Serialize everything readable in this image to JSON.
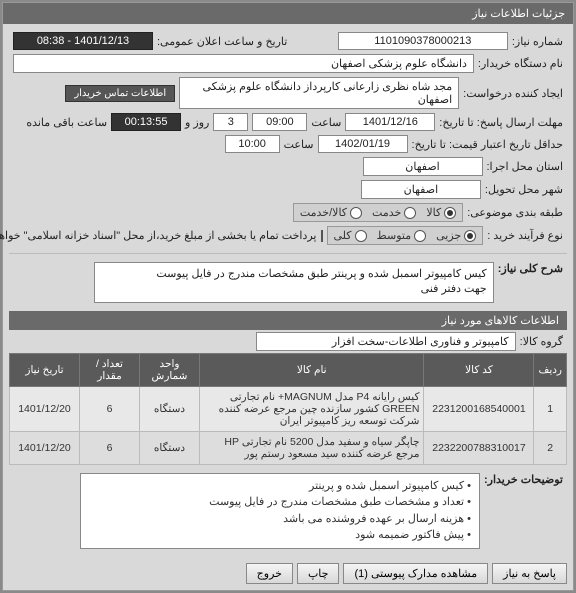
{
  "header": {
    "title": "جزئیات اطلاعات نیاز"
  },
  "top": {
    "need_no_lbl": "شماره نیاز:",
    "need_no": "1101090378000213",
    "public_time_lbl": "تاریخ و ساعت اعلان عمومی:",
    "public_time": "1401/12/13 - 08:38",
    "buyer_lbl": "نام دستگاه خریدار:",
    "buyer": "دانشگاه علوم پزشکی اصفهان",
    "creator_lbl": "ایجاد کننده درخواست:",
    "creator": "مجد شاه نظری زارعانی کارپرداز دانشگاه علوم پزشکی اصفهان",
    "contact": "اطلاعات تماس خریدار",
    "deadline_lbl": "مهلت ارسال پاسخ: تا تاریخ:",
    "deadline_date": "1401/12/16",
    "time_lbl": "ساعت",
    "deadline_time": "09:00",
    "days": "3",
    "days_lbl": "روز و",
    "countdown": "00:13:55",
    "remain_lbl": "ساعت باقی مانده",
    "validity_lbl": "حداقل تاریخ اعتبار قیمت: تا تاریخ:",
    "validity_date": "1402/01/19",
    "validity_time": "10:00",
    "exec_prov_lbl": "استان محل اجرا:",
    "exec_prov": "اصفهان",
    "deliv_city_lbl": "شهر محل تحویل:",
    "deliv_city": "اصفهان",
    "class_lbl": "طبقه بندی موضوعی:",
    "class_opts": {
      "a": "کالا",
      "b": "خدمت",
      "c": "کالا/خدمت"
    },
    "buy_lbl": "نوع فرآیند خرید :",
    "buy_opts": {
      "a": "جزیی",
      "b": "متوسط",
      "c": "کلی"
    },
    "pay_note": "پرداخت تمام یا بخشی از مبلغ خرید،از محل \"اسناد خزانه اسلامی\" خواهد بود."
  },
  "desc": {
    "lbl": "شرح کلی نیاز:",
    "text": "کیس کامپیوتر اسمبل شده و پرینتر طبق مشخصات مندرج در فایل پیوست\nجهت دفتر فنی"
  },
  "items": {
    "section": "اطلاعات کالاهای مورد نیاز",
    "group_lbl": "گروه کالا:",
    "group": "کامپیوتر و فناوری اطلاعات-سخت افزار",
    "cols": {
      "idx": "ردیف",
      "code": "کد کالا",
      "name": "نام کالا",
      "unit": "واحد شمارش",
      "qty": "تعداد / مقدار",
      "date": "تاریخ نیاز"
    },
    "rows": [
      {
        "idx": "1",
        "code": "2231200168540001",
        "name": "کیس رایانه P4 مدل MAGNUM+ نام تجارتی GREEN کشور سازنده چین مرجع عرضه کننده شرکت توسعه ریز کامپیوتر ایران",
        "unit": "دستگاه",
        "qty": "6",
        "date": "1401/12/20"
      },
      {
        "idx": "2",
        "code": "2232200788310017",
        "name": "چاپگر سیاه و سفید مدل 5200 نام تجارتی HP مرجع عرضه کننده سید مسعود رستم پور",
        "unit": "دستگاه",
        "qty": "6",
        "date": "1401/12/20"
      }
    ]
  },
  "notes": {
    "lbl": "توضیحات خریدار:",
    "lines": [
      "کیس کامپیوتر اسمبل شده و پرینتر",
      "تعداد و مشخصات طبق مشخصات مندرج در فایل پیوست",
      "هزینه ارسال بر عهده فروشنده می باشد",
      "پیش فاکتور ضمیمه شود"
    ]
  },
  "footer": {
    "answer": "پاسخ به نیاز",
    "attach": "مشاهده مدارک پیوستی (1)",
    "print": "چاپ",
    "exit": "خروج"
  }
}
